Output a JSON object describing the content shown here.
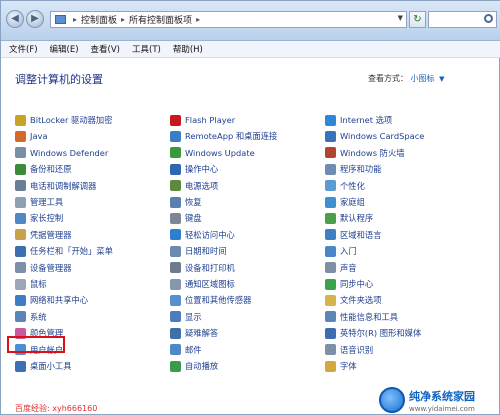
{
  "address": {
    "segments": [
      "控制面板",
      "所有控制面板项"
    ],
    "refresh_icon": "refresh-icon",
    "search_placeholder": ""
  },
  "menu": [
    "文件(F)",
    "编辑(E)",
    "查看(V)",
    "工具(T)",
    "帮助(H)"
  ],
  "heading": "调整计算机的设置",
  "view_by": {
    "label": "查看方式：",
    "value": "小图标"
  },
  "columns": [
    [
      {
        "label": "BitLocker 驱动器加密",
        "color": "#c9a227"
      },
      {
        "label": "Java",
        "color": "#d46a2a"
      },
      {
        "label": "Windows Defender",
        "color": "#7a8ea8"
      },
      {
        "label": "备份和还原",
        "color": "#3d8a3d"
      },
      {
        "label": "电话和调制解调器",
        "color": "#6b7e98"
      },
      {
        "label": "管理工具",
        "color": "#8c9fb5"
      },
      {
        "label": "家长控制",
        "color": "#4f86c6"
      },
      {
        "label": "凭据管理器",
        "color": "#c7a24b"
      },
      {
        "label": "任务栏和「开始」菜单",
        "color": "#3b6fb0"
      },
      {
        "label": "设备管理器",
        "color": "#7d8fa6"
      },
      {
        "label": "鼠标",
        "color": "#9aa7b8"
      },
      {
        "label": "网络和共享中心",
        "color": "#3e7cc7"
      },
      {
        "label": "系统",
        "color": "#5c84b8"
      },
      {
        "label": "颜色管理",
        "color": "#c65a9b"
      },
      {
        "label": "用户帐户",
        "color": "#4b8fd1"
      },
      {
        "label": "桌面小工具",
        "color": "#3d6fb5"
      }
    ],
    [
      {
        "label": "Flash Player",
        "color": "#c8181e"
      },
      {
        "label": "RemoteApp 和桌面连接",
        "color": "#3c7ec3"
      },
      {
        "label": "Windows Update",
        "color": "#3a9a3a"
      },
      {
        "label": "操作中心",
        "color": "#3166b0"
      },
      {
        "label": "电源选项",
        "color": "#5d8b3e"
      },
      {
        "label": "恢复",
        "color": "#5a7fb0"
      },
      {
        "label": "键盘",
        "color": "#7c8796"
      },
      {
        "label": "轻松访问中心",
        "color": "#2d7fd0"
      },
      {
        "label": "日期和时间",
        "color": "#6c89b0"
      },
      {
        "label": "设备和打印机",
        "color": "#6d7b8f"
      },
      {
        "label": "通知区域图标",
        "color": "#8597ad"
      },
      {
        "label": "位置和其他传感器",
        "color": "#5a8fcf"
      },
      {
        "label": "显示",
        "color": "#4a7cc0"
      },
      {
        "label": "疑难解答",
        "color": "#3d6fa8"
      },
      {
        "label": "邮件",
        "color": "#4d89c9"
      },
      {
        "label": "自动播放",
        "color": "#3c9a4e"
      }
    ],
    [
      {
        "label": "Internet 选项",
        "color": "#2d86d6"
      },
      {
        "label": "Windows CardSpace",
        "color": "#3772bd"
      },
      {
        "label": "Windows 防火墙",
        "color": "#b2452f"
      },
      {
        "label": "程序和功能",
        "color": "#6d8caf"
      },
      {
        "label": "个性化",
        "color": "#5a9bd3"
      },
      {
        "label": "家庭组",
        "color": "#3f8fd3"
      },
      {
        "label": "默认程序",
        "color": "#4aa04a"
      },
      {
        "label": "区域和语言",
        "color": "#3d7fc4"
      },
      {
        "label": "入门",
        "color": "#4a86c8"
      },
      {
        "label": "声音",
        "color": "#7e8fa4"
      },
      {
        "label": "同步中心",
        "color": "#3ca34d"
      },
      {
        "label": "文件夹选项",
        "color": "#d7b44a"
      },
      {
        "label": "性能信息和工具",
        "color": "#5c86b5"
      },
      {
        "label": "英特尔(R) 图形和媒体",
        "color": "#3c6fb0"
      },
      {
        "label": "语音识别",
        "color": "#7f90a6"
      },
      {
        "label": "字体",
        "color": "#d2a83e"
      }
    ]
  ],
  "footer_note": "百度经验: xyh666160",
  "brand": {
    "name": "纯净系统家园",
    "url": "www.yidaimei.com"
  }
}
